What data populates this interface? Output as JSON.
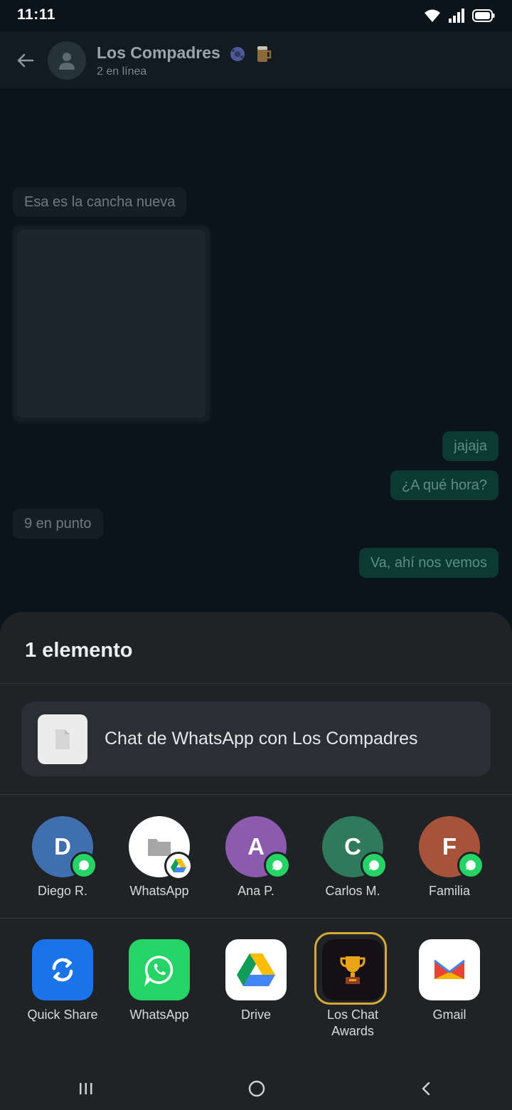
{
  "status_bar": {
    "time": "11:11"
  },
  "chat": {
    "group_name": "Los Compadres",
    "group_status": "2 en línea",
    "messages": [
      {
        "text": "Esa es la cancha nueva",
        "direction": "in"
      },
      {
        "text": "jajaja",
        "direction": "out"
      },
      {
        "text": "¿A qué hora?",
        "direction": "out"
      },
      {
        "text": "9 en punto",
        "direction": "in"
      },
      {
        "text": "Va, ahí nos vemos",
        "direction": "out"
      }
    ]
  },
  "share_sheet": {
    "title": "1 elemento",
    "preview_text": "Chat de WhatsApp con Los Compadres",
    "direct_targets": [
      {
        "initial": "D",
        "label": "Diego R.",
        "color": "#3f6fae",
        "badge": "whatsapp"
      },
      {
        "initial": "",
        "label": "WhatsApp",
        "color": "#ffffff",
        "badge": "drive"
      },
      {
        "initial": "A",
        "label": "Ana P.",
        "color": "#8c5bb0",
        "badge": "whatsapp"
      },
      {
        "initial": "C",
        "label": "Carlos M.",
        "color": "#2f7a5c",
        "badge": "whatsapp"
      },
      {
        "initial": "F",
        "label": "Familia",
        "color": "#a6533a",
        "badge": "whatsapp"
      }
    ],
    "apps": [
      {
        "label": "Quick Share",
        "icon": "quick-share-icon",
        "color": "#1a73e8"
      },
      {
        "label": "WhatsApp",
        "icon": "whatsapp-icon",
        "color": "#25d366"
      },
      {
        "label": "Drive",
        "icon": "drive-icon",
        "color": "#ffffff"
      },
      {
        "label_line1": "Los Chat",
        "label_line2": "Awards",
        "icon": "trophy-icon",
        "color": "#141016",
        "selected": true
      },
      {
        "label": "Gmail",
        "icon": "gmail-icon",
        "color": "#ffffff"
      }
    ]
  },
  "colors": {
    "accent_whatsapp": "#25d366",
    "selection_ring": "#d4a935",
    "sheet_background": "#1f2326"
  }
}
